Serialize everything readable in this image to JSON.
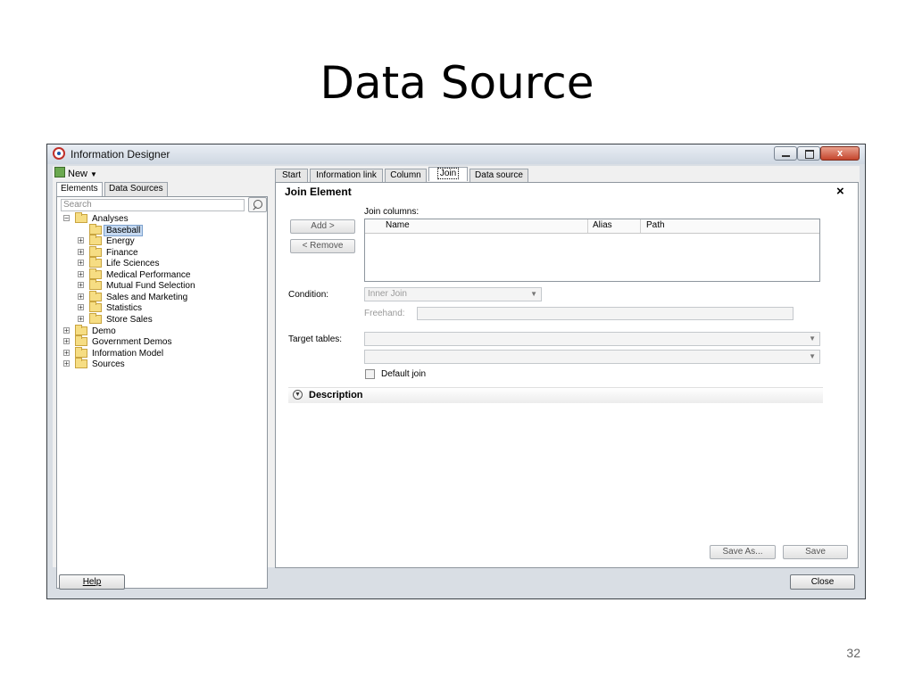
{
  "slide": {
    "title": "Data Source",
    "page_number": "32"
  },
  "window": {
    "title": "Information Designer",
    "close_glyph": "x",
    "icons": {
      "app": "information-designer-logo",
      "minimize": "minimize-icon",
      "maximize": "maximize-icon",
      "close": "close-icon"
    }
  },
  "left_panel": {
    "new_button": "New",
    "tabs": [
      "Elements",
      "Data Sources"
    ],
    "active_tab": "Elements",
    "search": {
      "placeholder": "Search"
    },
    "tree": [
      {
        "label": "Analyses",
        "expanded": true,
        "level": 0
      },
      {
        "label": "Baseball",
        "selected": true,
        "level": 1
      },
      {
        "label": "Energy",
        "level": 1
      },
      {
        "label": "Finance",
        "level": 1
      },
      {
        "label": "Life Sciences",
        "level": 1
      },
      {
        "label": "Medical Performance",
        "level": 1
      },
      {
        "label": "Mutual Fund Selection",
        "level": 1
      },
      {
        "label": "Sales and Marketing",
        "level": 1
      },
      {
        "label": "Statistics",
        "level": 1
      },
      {
        "label": "Store Sales",
        "level": 1
      },
      {
        "label": "Demo",
        "level": 0
      },
      {
        "label": "Government Demos",
        "level": 0
      },
      {
        "label": "Information Model",
        "level": 0
      },
      {
        "label": "Sources",
        "level": 0
      }
    ]
  },
  "right_panel": {
    "tabs": [
      "Start",
      "Information link",
      "Column",
      "Join",
      "Data source"
    ],
    "active_tab": "Join",
    "heading": "Join Element",
    "close_glyph": "×",
    "join_columns_label": "Join columns:",
    "add_button": "Add >",
    "remove_button": "< Remove",
    "table_headers": {
      "name": "Name",
      "alias": "Alias",
      "path": "Path"
    },
    "condition_label": "Condition:",
    "condition_value": "Inner Join",
    "freehand_label": "Freehand:",
    "target_tables_label": "Target tables:",
    "default_join_label": "Default join",
    "description_label": "Description",
    "save_as_button": "Save As...",
    "save_button": "Save"
  },
  "footer": {
    "help_button": "Help",
    "close_button": "Close"
  }
}
